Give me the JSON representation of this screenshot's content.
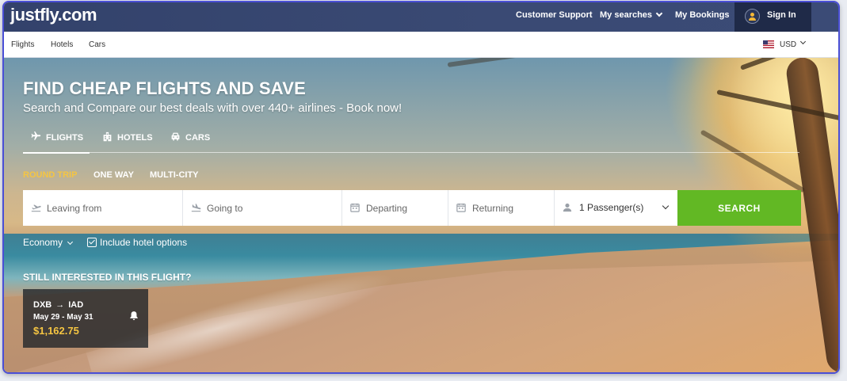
{
  "header": {
    "logo": "justfly.com",
    "nav": {
      "customer_support": "Customer Support",
      "my_searches": "My searches",
      "my_bookings": "My Bookings",
      "sign_in": "Sign In"
    }
  },
  "subnav": {
    "items": [
      "Flights",
      "Hotels",
      "Cars"
    ],
    "currency": "USD"
  },
  "hero": {
    "title": "FIND CHEAP FLIGHTS AND SAVE",
    "subtitle": "Search and Compare our best deals with over 440+ airlines - Book now!"
  },
  "tabs": [
    {
      "label": "FLIGHTS",
      "icon": "airplane-icon",
      "active": true
    },
    {
      "label": "HOTELS",
      "icon": "hotel-icon",
      "active": false
    },
    {
      "label": "CARS",
      "icon": "car-icon",
      "active": false
    }
  ],
  "trip_types": [
    {
      "label": "ROUND TRIP",
      "active": true
    },
    {
      "label": "ONE WAY",
      "active": false
    },
    {
      "label": "MULTI-CITY",
      "active": false
    }
  ],
  "search": {
    "leaving_placeholder": "Leaving from",
    "going_placeholder": "Going to",
    "departing_placeholder": "Departing",
    "returning_placeholder": "Returning",
    "passengers": "1 Passenger(s)",
    "button": "SEARCH"
  },
  "options": {
    "cabin": "Economy",
    "include_hotel": "Include hotel options",
    "include_hotel_checked": true
  },
  "recent": {
    "title": "STILL INTERESTED IN THIS FLIGHT?",
    "card": {
      "from": "DXB",
      "arrow": "→",
      "to": "IAD",
      "dates": "May 29 - May 31",
      "price": "$1,162.75"
    }
  },
  "colors": {
    "nav_bg": "#3a4a74",
    "signin_bg": "#1f2a48",
    "accent_yellow": "#f5c542",
    "search_green": "#62b824"
  }
}
